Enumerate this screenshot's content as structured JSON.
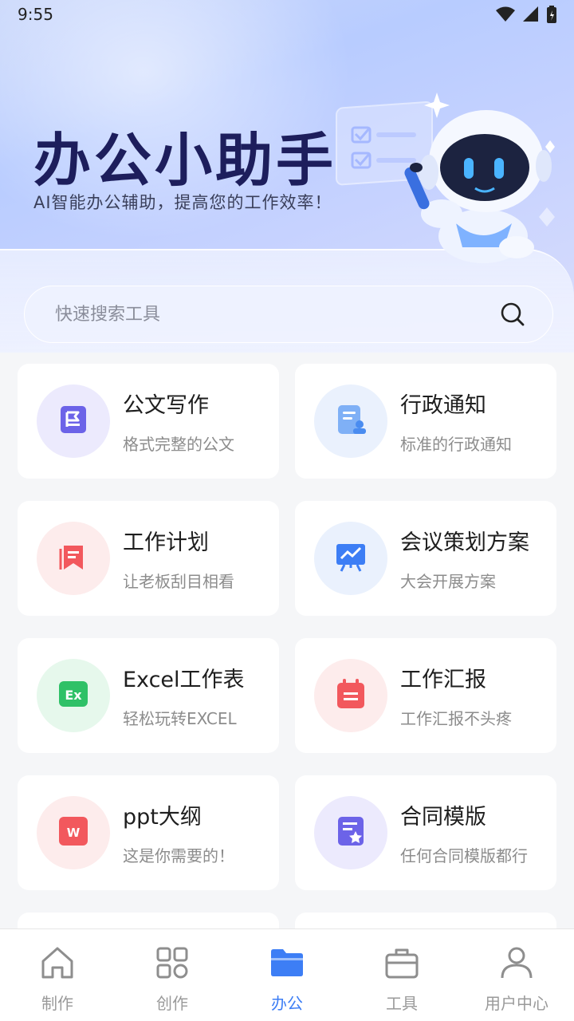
{
  "status_bar": {
    "time": "9:55"
  },
  "hero": {
    "title": "办公小助手",
    "subtitle": "AI智能办公辅助，提高您的工作效率！"
  },
  "search": {
    "placeholder": "快速搜索工具"
  },
  "cards": [
    {
      "title": "公文写作",
      "desc": "格式完整的公文",
      "icon": "document-flag-icon",
      "bg": "#eceafd",
      "fg": "#6c63e8"
    },
    {
      "title": "行政通知",
      "desc": "标准的行政通知",
      "icon": "notice-user-icon",
      "bg": "#eaf1fd",
      "fg": "#4a8cf0"
    },
    {
      "title": "工作计划",
      "desc": "让老板刮目相看",
      "icon": "bookmark-plan-icon",
      "bg": "#fdecec",
      "fg": "#f2585d"
    },
    {
      "title": "会议策划方案",
      "desc": "大会开展方案",
      "icon": "presentation-chart-icon",
      "bg": "#eaf1fd",
      "fg": "#3d7ef5"
    },
    {
      "title": "Excel工作表",
      "desc": "轻松玩转EXCEL",
      "icon": "excel-icon",
      "bg": "#e6f8ec",
      "fg": "#2fc167"
    },
    {
      "title": "工作汇报",
      "desc": "工作汇报不头疼",
      "icon": "calendar-report-icon",
      "bg": "#fdecec",
      "fg": "#f2585d"
    },
    {
      "title": "ppt大纲",
      "desc": "这是你需要的！",
      "icon": "word-icon",
      "bg": "#fdecec",
      "fg": "#f2585d"
    },
    {
      "title": "合同模版",
      "desc": "任何合同模版都行",
      "icon": "contract-star-icon",
      "bg": "#eceafd",
      "fg": "#6c63e8"
    }
  ],
  "tabs": [
    {
      "label": "制作",
      "icon": "home-icon",
      "active": false
    },
    {
      "label": "创作",
      "icon": "grid-icon",
      "active": false
    },
    {
      "label": "办公",
      "icon": "folder-icon",
      "active": true
    },
    {
      "label": "工具",
      "icon": "toolbox-icon",
      "active": false
    },
    {
      "label": "用户中心",
      "icon": "user-icon",
      "active": false
    }
  ],
  "colors": {
    "accent": "#3d7ef5",
    "title": "#1d1e5c"
  }
}
